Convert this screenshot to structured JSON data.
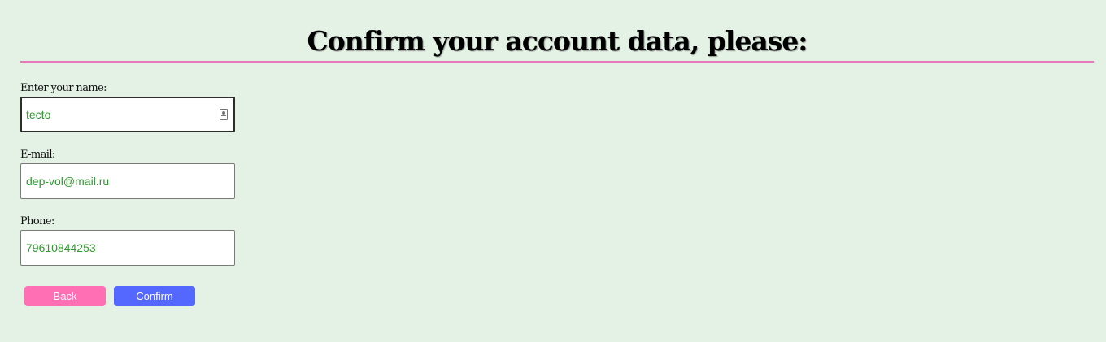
{
  "page": {
    "title": "Confirm your account data, please:"
  },
  "form": {
    "name": {
      "label": "Enter your name:",
      "value": "tecto",
      "icon": "contact-autofill-icon"
    },
    "email": {
      "label": "E-mail:",
      "value": "dep-vol@mail.ru"
    },
    "phone": {
      "label": "Phone:",
      "value": "79610844253"
    }
  },
  "actions": {
    "back_label": "Back",
    "confirm_label": "Confirm"
  },
  "colors": {
    "background": "#e4f1e5",
    "divider": "#e47ab8",
    "input_text": "#2d9a2d",
    "back_button": "#ff6fb4",
    "confirm_button": "#5467ff"
  }
}
